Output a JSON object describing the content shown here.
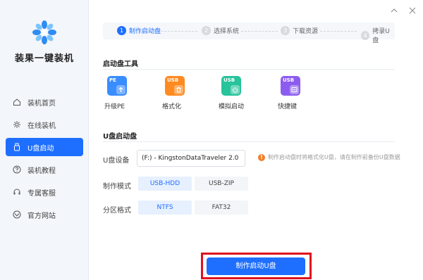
{
  "app": {
    "name": "装果一键装机"
  },
  "sidebar": {
    "items": [
      {
        "label": "装机首页",
        "icon": "home-icon",
        "active": false
      },
      {
        "label": "在线装机",
        "icon": "online-install-icon",
        "active": false
      },
      {
        "label": "U盘启动",
        "icon": "usb-drive-icon",
        "active": true
      },
      {
        "label": "装机教程",
        "icon": "help-icon",
        "active": false
      },
      {
        "label": "专属客服",
        "icon": "headset-icon",
        "active": false
      },
      {
        "label": "官方网站",
        "icon": "website-icon",
        "active": false
      }
    ]
  },
  "steps": [
    {
      "num": "1",
      "label": "制作启动盘",
      "active": true
    },
    {
      "num": "2",
      "label": "选择系统",
      "active": false
    },
    {
      "num": "3",
      "label": "下载资源",
      "active": false
    },
    {
      "num": "4",
      "label": "拷录U盘",
      "active": false
    }
  ],
  "tools_section": {
    "title": "启动盘工具",
    "tools": [
      {
        "badge": "PE",
        "label": "升级PE",
        "color": "#3a8dff",
        "icon": "upgrade-icon"
      },
      {
        "badge": "USB",
        "label": "格式化",
        "color": "#ff8a1f",
        "icon": "trash-icon"
      },
      {
        "badge": "USB",
        "label": "模拟启动",
        "color": "#27c39b",
        "icon": "power-icon"
      },
      {
        "badge": "USB",
        "label": "快捷键",
        "color": "#8c5cf0",
        "icon": "keyboard-icon"
      }
    ]
  },
  "usb_section": {
    "title": "U盘启动盘",
    "device_label": "U盘设备",
    "device_value": "(F:) - KingstonDataTraveler 2.0",
    "warning": "制作启动盘时将格式化U盘，请在制作前备份U盘数据",
    "mode_label": "制作模式",
    "modes": [
      {
        "label": "USB-HDD",
        "selected": true
      },
      {
        "label": "USB-ZIP",
        "selected": false
      }
    ],
    "partition_label": "分区格式",
    "partitions": [
      {
        "label": "NTFS",
        "selected": true
      },
      {
        "label": "FAT32",
        "selected": false
      }
    ]
  },
  "actions": {
    "make_label": "制作启动U盘"
  },
  "colors": {
    "accent": "#1e6fff",
    "highlight": "#e0111d"
  }
}
